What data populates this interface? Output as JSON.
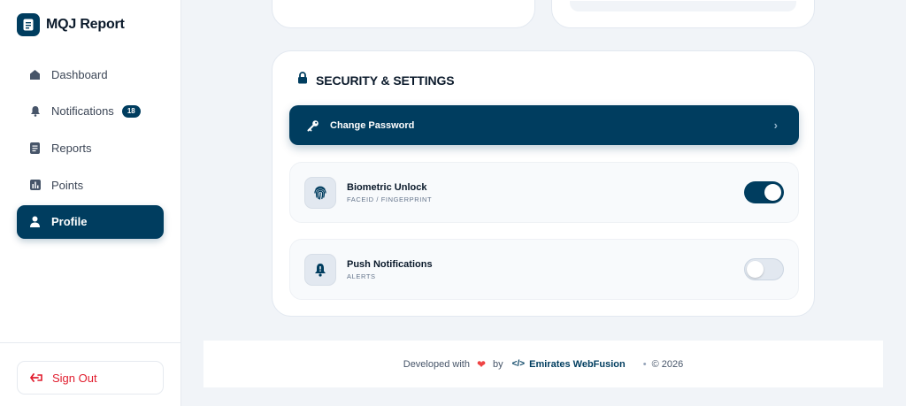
{
  "brand": {
    "title": "MQJ Report"
  },
  "sidebar": {
    "items": [
      {
        "label": "Dashboard",
        "icon": "home-icon"
      },
      {
        "label": "Notifications",
        "icon": "bell-icon",
        "badge": "18"
      },
      {
        "label": "Reports",
        "icon": "report-icon"
      },
      {
        "label": "Points",
        "icon": "bar-chart-icon"
      },
      {
        "label": "Profile",
        "icon": "user-icon",
        "active": true
      }
    ],
    "signout_label": "Sign Out"
  },
  "settings": {
    "title": "SECURITY & SETTINGS",
    "change_password_label": "Change Password",
    "rows": [
      {
        "label": "Biometric Unlock",
        "sub": "FACEID / FINGERPRINT",
        "icon": "fingerprint-icon",
        "enabled": true
      },
      {
        "label": "Push Notifications",
        "sub": "ALERTS",
        "icon": "bell-icon",
        "enabled": false
      }
    ]
  },
  "footer": {
    "developed_with": "Developed with",
    "by": "by",
    "company": "Emirates WebFusion",
    "separator": "•",
    "year": "© 2026"
  },
  "colors": {
    "primary": "#003d5f",
    "danger": "#e11d2e",
    "background": "#f1f4f8"
  }
}
